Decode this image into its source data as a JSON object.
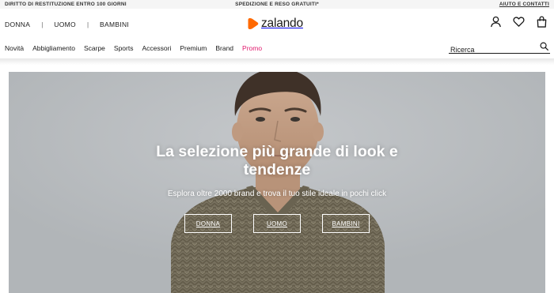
{
  "topbar": {
    "returns": "DIRITTO DI RESTITUZIONE ENTRO 100 GIORNI",
    "shipping": "SPEDIZIONE E RESO GRATUITI*",
    "help": "AIUTO E CONTATTI"
  },
  "gender_nav": {
    "items": [
      "DONNA",
      "UOMO",
      "BAMBINI"
    ],
    "separator": "|"
  },
  "brand": {
    "name": "zalando",
    "color": "#ff6900"
  },
  "header_icons": [
    "account-icon",
    "wishlist-heart-icon",
    "shopping-bag-icon"
  ],
  "category_nav": {
    "items": [
      "Novità",
      "Abbigliamento",
      "Scarpe",
      "Sports",
      "Accessori",
      "Premium",
      "Brand"
    ],
    "promo": "Promo",
    "promo_color": "#e0186c"
  },
  "search": {
    "placeholder": "Ricerca",
    "icon": "search-icon"
  },
  "hero": {
    "title_line1": "La selezione più grande di look e",
    "title_line2": "tendenze",
    "subtitle": "Esplora oltre 2000 brand e trova il tuo stile ideale in pochi click",
    "buttons": [
      "DONNA",
      "UOMO",
      "BAMBINI"
    ]
  }
}
